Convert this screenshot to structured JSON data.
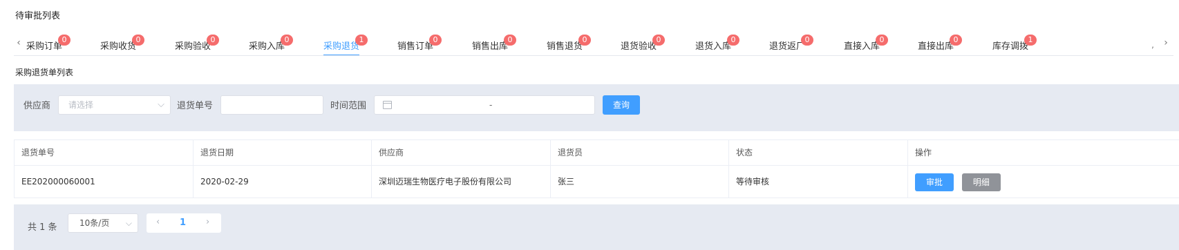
{
  "page_title": "待审批列表",
  "tabs": [
    {
      "label": "采购订单",
      "badge": "0"
    },
    {
      "label": "采购收货",
      "badge": "0"
    },
    {
      "label": "采购验收",
      "badge": "0"
    },
    {
      "label": "采购入库",
      "badge": "0"
    },
    {
      "label": "采购退货",
      "badge": "1"
    },
    {
      "label": "销售订单",
      "badge": "0"
    },
    {
      "label": "销售出库",
      "badge": "0"
    },
    {
      "label": "销售退货",
      "badge": "0"
    },
    {
      "label": "退货验收",
      "badge": "0"
    },
    {
      "label": "退货入库",
      "badge": "0"
    },
    {
      "label": "退货返厂",
      "badge": "0"
    },
    {
      "label": "直接入库",
      "badge": "0"
    },
    {
      "label": "直接出库",
      "badge": "0"
    },
    {
      "label": "库存调拨",
      "badge": "1"
    }
  ],
  "active_tab": "采购退货",
  "tab_nav": {
    "prev": "‹",
    "next": "›",
    "more": ","
  },
  "section_title": "采购退货单列表",
  "filter": {
    "supplier_label": "供应商",
    "supplier_placeholder": "请选择",
    "return_no_label": "退货单号",
    "return_no_value": "",
    "time_range_label": "时间范围",
    "time_range_separator": "-",
    "query_button": "查询"
  },
  "table": {
    "headers": [
      "退货单号",
      "退货日期",
      "供应商",
      "退货员",
      "状态",
      "操作"
    ],
    "rows": [
      {
        "return_no": "EE202000060001",
        "date": "2020-02-29",
        "supplier": "深圳迈瑞生物医疗电子股份有限公司",
        "returner": "张三",
        "status": "等待审核",
        "actions": [
          "审批",
          "明细"
        ]
      }
    ]
  },
  "pagination": {
    "total_text": "共 1 条",
    "page_size": "10条/页",
    "current_page": "1"
  },
  "colors": {
    "accent": "#409eff",
    "badge": "#f56c6c",
    "panel_bg": "#e6eaf2",
    "detail_button": "#909399"
  },
  "icons": {
    "tab_prev": "chevron-left-icon",
    "tab_next": "chevron-right-icon",
    "select_arrow": "chevron-down-icon",
    "date": "calendar-icon"
  }
}
